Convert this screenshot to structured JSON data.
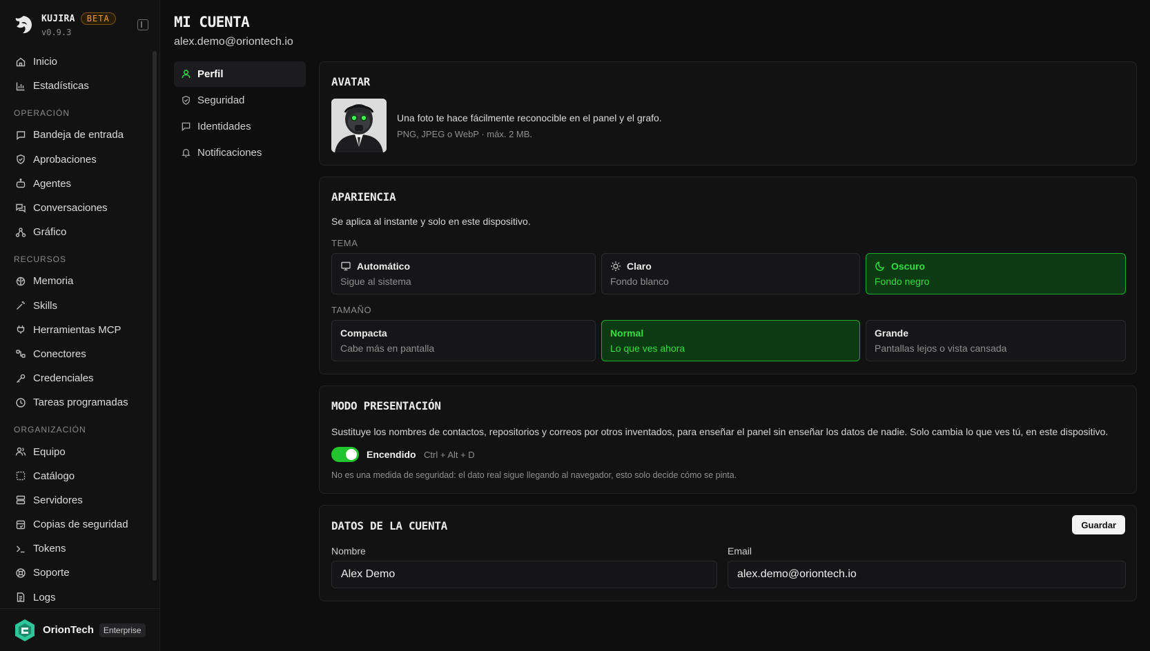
{
  "brand": {
    "name": "KUJIRA",
    "badge": "BETA",
    "version": "v0.9.3"
  },
  "sidebar": {
    "top": [
      {
        "label": "Inicio",
        "icon": "home-icon"
      },
      {
        "label": "Estadísticas",
        "icon": "bar-chart-icon"
      }
    ],
    "sections": [
      {
        "title": "OPERACIÓN",
        "items": [
          {
            "label": "Bandeja de entrada",
            "icon": "inbox-icon"
          },
          {
            "label": "Aprobaciones",
            "icon": "shield-check-icon"
          },
          {
            "label": "Agentes",
            "icon": "bot-icon"
          },
          {
            "label": "Conversaciones",
            "icon": "chat-icon"
          },
          {
            "label": "Gráfico",
            "icon": "graph-icon"
          }
        ]
      },
      {
        "title": "RECURSOS",
        "items": [
          {
            "label": "Memoria",
            "icon": "brain-icon"
          },
          {
            "label": "Skills",
            "icon": "wand-icon"
          },
          {
            "label": "Herramientas MCP",
            "icon": "plug-icon"
          },
          {
            "label": "Conectores",
            "icon": "connector-icon"
          },
          {
            "label": "Credenciales",
            "icon": "key-icon"
          },
          {
            "label": "Tareas programadas",
            "icon": "clock-icon"
          }
        ]
      },
      {
        "title": "ORGANIZACIÓN",
        "items": [
          {
            "label": "Equipo",
            "icon": "users-icon"
          },
          {
            "label": "Catálogo",
            "icon": "catalog-icon"
          },
          {
            "label": "Servidores",
            "icon": "server-icon"
          },
          {
            "label": "Copias de seguridad",
            "icon": "backup-icon"
          },
          {
            "label": "Tokens",
            "icon": "terminal-icon"
          },
          {
            "label": "Soporte",
            "icon": "lifebuoy-icon"
          },
          {
            "label": "Logs",
            "icon": "file-text-icon"
          }
        ]
      }
    ]
  },
  "org": {
    "name": "OrionTech",
    "plan": "Enterprise"
  },
  "page": {
    "title": "MI CUENTA",
    "subtitle": "alex.demo@oriontech.io"
  },
  "subnav": [
    {
      "label": "Perfil",
      "icon": "user-icon",
      "active": true
    },
    {
      "label": "Seguridad",
      "icon": "shield-icon",
      "active": false
    },
    {
      "label": "Identidades",
      "icon": "message-square-icon",
      "active": false
    },
    {
      "label": "Notificaciones",
      "icon": "bell-icon",
      "active": false
    }
  ],
  "avatar": {
    "title": "AVATAR",
    "description": "Una foto te hace fácilmente reconocible en el panel y el grafo.",
    "hint": "PNG, JPEG o WebP · máx. 2 MB."
  },
  "appearance": {
    "title": "APARIENCIA",
    "description": "Se aplica al instante y solo en este dispositivo.",
    "theme_label": "TEMA",
    "themes": [
      {
        "title": "Automático",
        "desc": "Sigue al sistema",
        "icon": "monitor-icon",
        "selected": false
      },
      {
        "title": "Claro",
        "desc": "Fondo blanco",
        "icon": "sun-icon",
        "selected": false
      },
      {
        "title": "Oscuro",
        "desc": "Fondo negro",
        "icon": "moon-icon",
        "selected": true
      }
    ],
    "size_label": "TAMAÑO",
    "sizes": [
      {
        "title": "Compacta",
        "desc": "Cabe más en pantalla",
        "selected": false
      },
      {
        "title": "Normal",
        "desc": "Lo que ves ahora",
        "selected": true
      },
      {
        "title": "Grande",
        "desc": "Pantallas lejos o vista cansada",
        "selected": false
      }
    ]
  },
  "presentation": {
    "title": "MODO PRESENTACIÓN",
    "description": "Sustituye los nombres de contactos, repositorios y correos por otros inventados, para enseñar el panel sin enseñar los datos de nadie. Solo cambia lo que ves tú, en este dispositivo.",
    "toggle_label": "Encendido",
    "shortcut": "Ctrl + Alt + D",
    "note": "No es una medida de seguridad: el dato real sigue llegando al navegador, esto solo decide cómo se pinta."
  },
  "account": {
    "title": "DATOS DE LA CUENTA",
    "save_label": "Guardar",
    "name_label": "Nombre",
    "name_value": "Alex Demo",
    "email_label": "Email",
    "email_value": "alex.demo@oriontech.io"
  },
  "colors": {
    "accent": "#22c52d",
    "selected_bg": "#0c3a12",
    "beta": "#f0a020"
  }
}
